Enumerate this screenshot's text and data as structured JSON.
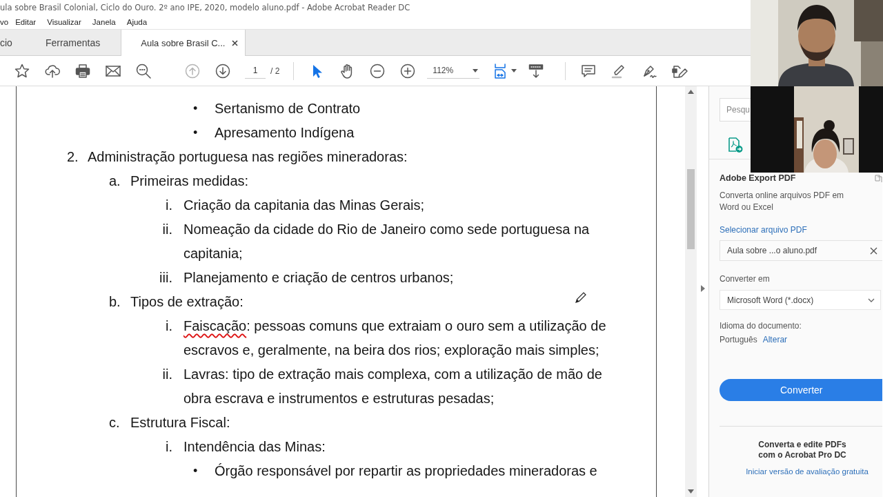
{
  "window": {
    "title": "ula sobre Brasil Colonial, Ciclo do Ouro. 2º ano IPE, 2020, modelo aluno.pdf - Adobe Acrobat Reader DC"
  },
  "menu": [
    "vo",
    "Editar",
    "Visualizar",
    "Janela",
    "Ajuda"
  ],
  "tabs": [
    {
      "label": "cio",
      "selected": false
    },
    {
      "label": "Ferramentas",
      "selected": false
    },
    {
      "label": "Aula sobre Brasil C...",
      "selected": true,
      "closable": true
    }
  ],
  "toolbar": {
    "file_tools": [
      {
        "kind": "star"
      },
      {
        "kind": "upload"
      },
      {
        "kind": "print"
      },
      {
        "kind": "mail"
      },
      {
        "kind": "search"
      }
    ],
    "nav": [
      {
        "kind": "up",
        "disabled": true
      },
      {
        "kind": "down",
        "disabled": false
      }
    ],
    "page": "1",
    "page_total": "/ 2",
    "tools": [
      {
        "kind": "select",
        "selected": true
      },
      {
        "kind": "hand",
        "selected": false
      }
    ],
    "zoom_tools": [
      {
        "kind": "zoom-out"
      },
      {
        "kind": "zoom-in"
      }
    ],
    "zoom": "112%",
    "view_tools": [
      {
        "kind": "fit"
      },
      {
        "kind": "scroll"
      }
    ],
    "edit_tools": [
      {
        "kind": "comment"
      },
      {
        "kind": "highlight"
      },
      {
        "kind": "sign"
      },
      {
        "kind": "edit"
      }
    ]
  },
  "outline": [
    {
      "kind": "bullet",
      "marker": "•",
      "text": "Sertanismo de Contrato"
    },
    {
      "kind": "bullet",
      "marker": "•",
      "text": "Apresamento Indígena"
    },
    {
      "kind": "number",
      "marker": "2.",
      "text": "Administração portuguesa nas regiões mineradoras:",
      "children": [
        {
          "kind": "letter",
          "marker": "a.",
          "text": "Primeiras medidas:",
          "children": [
            {
              "kind": "roman",
              "marker": "i.",
              "text": "Criação da capitania das Minas Gerais;"
            },
            {
              "kind": "roman",
              "marker": "ii.",
              "text": "Nomeação da cidade do Rio de Janeiro como sede portuguesa na capitania;"
            },
            {
              "kind": "roman",
              "marker": "iii.",
              "text": "Planejamento e criação de centros urbanos;"
            }
          ]
        },
        {
          "kind": "letter",
          "marker": "b.",
          "text": "Tipos de extração:",
          "children": [
            {
              "kind": "roman",
              "marker": "i.",
              "lead": "Faiscação",
              "lead_misspelled": true,
              "text": ": pessoas comuns que extraiam o ouro sem a utilização de escravos e, geralmente, na beira dos rios; exploração mais simples;"
            },
            {
              "kind": "roman",
              "marker": "ii.",
              "text": "Lavras: tipo de extração mais complexa, com a utilização de mão de obra escrava e instrumentos e estruturas pesadas;"
            }
          ]
        },
        {
          "kind": "letter",
          "marker": "c.",
          "text": "Estrutura Fiscal:",
          "children": [
            {
              "kind": "roman",
              "marker": "i.",
              "text": "Intendência das Minas:",
              "children": [
                {
                  "kind": "bullet",
                  "marker": "•",
                  "text": "Órgão responsável por repartir as propriedades mineradoras e"
                }
              ]
            }
          ]
        }
      ]
    }
  ],
  "panel": {
    "search_placeholder": "Pesqu",
    "title": "Adobe Export PDF",
    "description": "Converta online arquivos PDF em Word ou Excel",
    "select_link": "Selecionar arquivo PDF",
    "file": "Aula sobre ...o aluno.pdf",
    "convert_label": "Converter em",
    "format": "Microsoft Word (*.docx)",
    "language_label": "Idioma do documento:",
    "language": "Português",
    "change_link": "Alterar",
    "convert_button": "Converter",
    "promo_lines": [
      "Converta e edite PDFs",
      "com o Acrobat Pro DC"
    ],
    "trial_link": "Iniciar versão de avaliação gratuita"
  }
}
